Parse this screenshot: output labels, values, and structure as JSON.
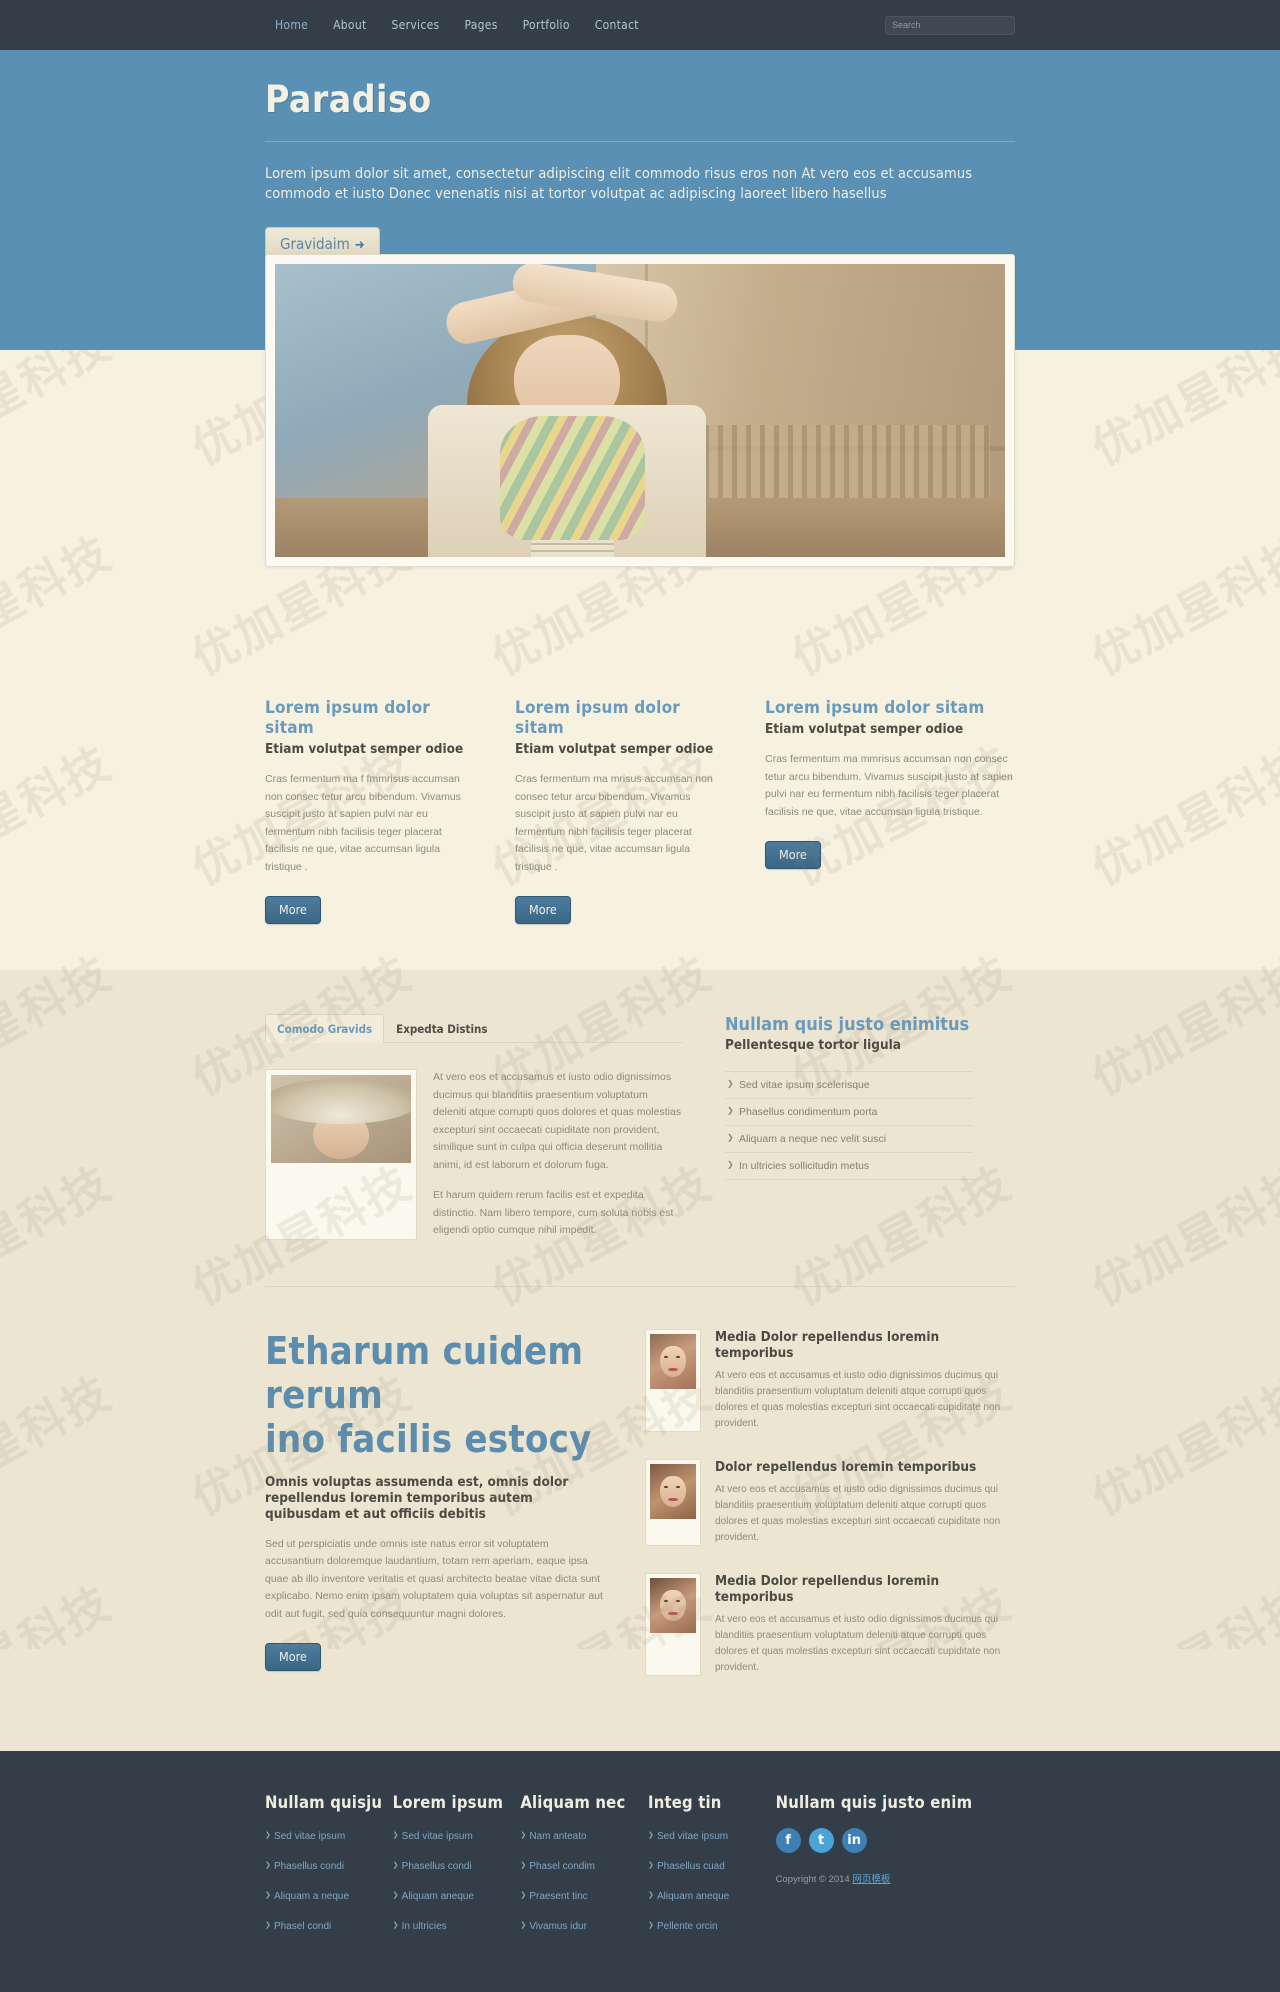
{
  "nav": {
    "items": [
      {
        "label": "Home",
        "active": true
      },
      {
        "label": "About",
        "active": false
      },
      {
        "label": "Services",
        "active": false
      },
      {
        "label": "Pages",
        "active": false
      },
      {
        "label": "Portfolio",
        "active": false
      },
      {
        "label": "Contact",
        "active": false
      }
    ],
    "search_placeholder": "Search"
  },
  "hero": {
    "title": "Paradiso",
    "paragraph": "Lorem ipsum dolor sit amet, consectetur adipiscing elit commodo risus eros non At vero eos et accusamus commodo et iusto Donec venenatis nisi at tortor volutpat ac adipiscing laoreet libero hasellus",
    "cta_label": "Gravidaim",
    "cta_arrow": "➜",
    "image_alt": "fashion-model-hero-photo"
  },
  "features": [
    {
      "title": "Lorem ipsum dolor sitam",
      "subtitle": "Etiam volutpat semper odioe",
      "body": "Cras fermentum ma f fmmrisus accumsan non consec tetur arcu bibendum. Vivamus suscipit justo at sapien pulvi nar eu fermentum nibh facilisis teger placerat facilisis ne que, vitae accumsan ligula tristique .",
      "more_label": "More"
    },
    {
      "title": "Lorem ipsum dolor sitam",
      "subtitle": "Etiam volutpat semper odioe",
      "body": "Cras fermentum ma mrisus accumsan non consec tetur arcu bibendum. Vivamus suscipit justo at sapien pulvi nar eu fermentum nibh facilisis teger placerat facilisis ne que, vitae accumsan ligula tristique .",
      "more_label": "More"
    },
    {
      "title": "Lorem ipsum dolor sitam",
      "subtitle": "Etiam volutpat semper odioe",
      "body": "Cras fermentum ma mmrisus accumsan non consec tetur arcu bibendum. Vivamus suscipit justo at sapien pulvi nar eu fermentum nibh facilisis teger placerat facilisis ne que, vitae accumsan ligula tristique.",
      "more_label": "More"
    }
  ],
  "tabs": {
    "items": [
      {
        "label": "Comodo Gravids",
        "active": true
      },
      {
        "label": "Expedta Distins",
        "active": false
      }
    ],
    "image_alt": "woman-in-sun-hat-thumbnail",
    "paragraph1": "At vero eos et accusamus et iusto odio dignissimos ducimus qui blanditiis praesentium voluptatum deleniti atque corrupti quos dolores et quas molestias excepturi sint occaecati cupiditate non provident, similique sunt in culpa qui officia deserunt mollitia animi, id est laborum et dolorum fuga.",
    "paragraph2": "Et harum quidem rerum facilis est et expedita distinctio. Nam libero tempore, cum soluta nobis est eligendi optio cumque nihil impedit."
  },
  "sidebar": {
    "title": "Nullam quis justo enimitus",
    "subtitle": "Pellentesque tortor ligula",
    "links": [
      "Sed vitae ipsum scelerisque",
      "Phasellus condimentum porta",
      "Aliquam a neque nec velit susci",
      "In ultricies sollicitudin metus"
    ]
  },
  "big": {
    "title_line1": "Etharum cuidem rerum",
    "title_line2": "ino facilis estocy",
    "subtitle": "Omnis voluptas assumenda est, omnis dolor repellendus loremin temporibus autem quibusdam et aut officiis debitis",
    "body": "Sed ut perspiciatis unde omnis iste natus error sit voluptatem accusantium doloremque laudantium, totam rem aperiam, eaque ipsa quae ab illo inventore veritatis et quasi architecto beatae vitae dicta sunt explicabo. Nemo enim ipsam voluptatem quia voluptas sit aspernatur aut odit aut fugit, sed quia consequuntur magni dolores.",
    "more_label": "More"
  },
  "news": [
    {
      "title": "Media Dolor repellendus loremin temporibus",
      "body": "At vero eos et accusamus et iusto odio dignissimos ducimus qui blanditiis praesentium voluptatum deleniti atque corrupti quos dolores et quas molestias excepturi sint occaecati cupiditate non provident.",
      "image_alt": "portrait-thumbnail-1"
    },
    {
      "title": "Dolor repellendus loremin temporibus",
      "body": "At vero eos et accusamus et iusto odio dignissimos ducimus qui blanditiis praesentium voluptatum deleniti atque corrupti quos dolores et quas molestias excepturi sint occaecati cupiditate non provident.",
      "image_alt": "portrait-thumbnail-2"
    },
    {
      "title": "Media Dolor repellendus loremin temporibus",
      "body": "At vero eos et accusamus et iusto odio dignissimos ducimus qui blanditiis praesentium voluptatum deleniti atque corrupti quos dolores et quas molestias excepturi sint occaecati cupiditate non provident.",
      "image_alt": "portrait-thumbnail-3"
    }
  ],
  "footer": {
    "columns": [
      {
        "title": "Nullam quisju",
        "links": [
          "Sed vitae ipsum",
          "Phasellus condi",
          "Aliquam a neque",
          "Phasel condi"
        ]
      },
      {
        "title": "Lorem ipsum",
        "links": [
          "Sed vitae ipsum",
          "Phasellus condi",
          "Aliquam aneque",
          "In ultricies"
        ]
      },
      {
        "title": "Aliquam nec",
        "links": [
          "Nam anteato",
          "Phasel condim",
          "Praesent tinc",
          "Vivamus idur"
        ]
      },
      {
        "title": "Integ tin",
        "links": [
          "Sed vitae ipsum",
          "Phasellus cuad",
          "Aliquam aneque",
          "Pellente orcin"
        ]
      }
    ],
    "social_title": "Nullam quis justo enim",
    "socials": [
      {
        "name": "facebook-icon",
        "glyph": "f"
      },
      {
        "name": "twitter-icon",
        "glyph": "t"
      },
      {
        "name": "linkedin-icon",
        "glyph": "in"
      }
    ],
    "copyright_prefix": "Copyright © 2014 ",
    "copyright_link": "网页模板"
  },
  "watermark": {
    "text": "优加星科技"
  },
  "colors": {
    "navbar": "#343e48",
    "hero": "#5a90b4",
    "cream": "#f7f1e0",
    "beige": "#ece5d1",
    "accent": "#6b9abb",
    "button": "#3a6786"
  }
}
